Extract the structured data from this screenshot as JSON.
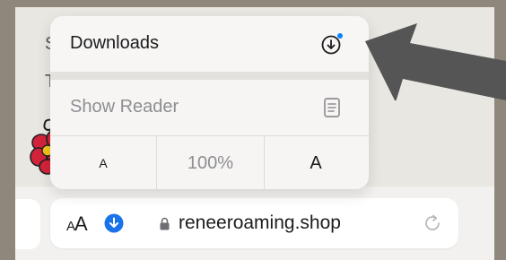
{
  "page": {
    "background_letters": [
      "S",
      "T"
    ]
  },
  "menu": {
    "downloads_label": "Downloads",
    "show_reader_label": "Show Reader",
    "font_smaller_label": "A",
    "zoom_level": "100%",
    "font_larger_label": "A"
  },
  "toolbar": {
    "reader_aa_small": "A",
    "reader_aa_large": "A",
    "url": "reneeroaming.shop"
  },
  "icons": {
    "downloads": "download-arrow-circle-icon",
    "reader": "document-icon",
    "downloads_badge": "download-badge-icon",
    "lock": "lock-icon",
    "reload": "reload-icon",
    "arrow": "annotation-arrow"
  },
  "colors": {
    "accent_blue": "#0a84ff",
    "badge_blue": "#1a73e8",
    "arrow_gray": "#555555"
  }
}
